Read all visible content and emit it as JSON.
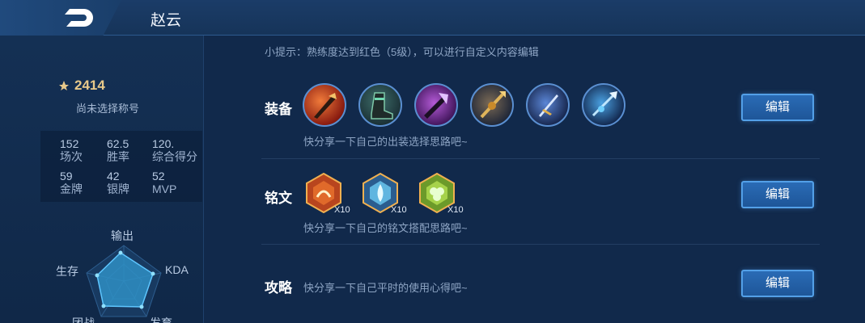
{
  "header": {
    "hero_name": "赵云",
    "back_icon": "back-arrow-icon"
  },
  "profile": {
    "score": "2414",
    "title_status": "尚未选择称号",
    "stats": [
      {
        "value": "152",
        "label": "场次"
      },
      {
        "value": "62.5",
        "label": "胜率"
      },
      {
        "value": "120.",
        "label": "综合得分"
      },
      {
        "value": "59",
        "label": "金牌"
      },
      {
        "value": "42",
        "label": "银牌"
      },
      {
        "value": "52",
        "label": "MVP"
      }
    ],
    "radar": {
      "labels": {
        "top": "输出",
        "left": "生存",
        "right": "KDA",
        "bottom_left": "团战",
        "bottom_right": "发育"
      }
    }
  },
  "main": {
    "tip": "小提示：熟练度达到红色（5级），可以进行自定义内容编辑",
    "equipment": {
      "title": "装备",
      "hint": "快分享一下自己的出装选择思路吧~",
      "edit_label": "编辑",
      "items": [
        "red-sword-item-icon",
        "boots-item-icon",
        "purple-axe-item-icon",
        "golden-spear-item-icon",
        "blue-blade-item-icon",
        "ice-spear-item-icon"
      ]
    },
    "inscription": {
      "title": "铭文",
      "hint": "快分享一下自己的铭文搭配思路吧~",
      "edit_label": "编辑",
      "runes": [
        {
          "icon": "red-rune-icon",
          "count": "X10"
        },
        {
          "icon": "blue-rune-icon",
          "count": "X10"
        },
        {
          "icon": "green-rune-icon",
          "count": "X10"
        }
      ]
    },
    "strategy": {
      "title": "攻略",
      "hint": "快分享一下自己平时的使用心得吧~",
      "edit_label": "编辑"
    }
  },
  "colors": {
    "background": "#11294b",
    "accent_button": "#2a6bb5",
    "score_gold": "#e8c98a",
    "radar_fill": "#2f8fc4"
  }
}
